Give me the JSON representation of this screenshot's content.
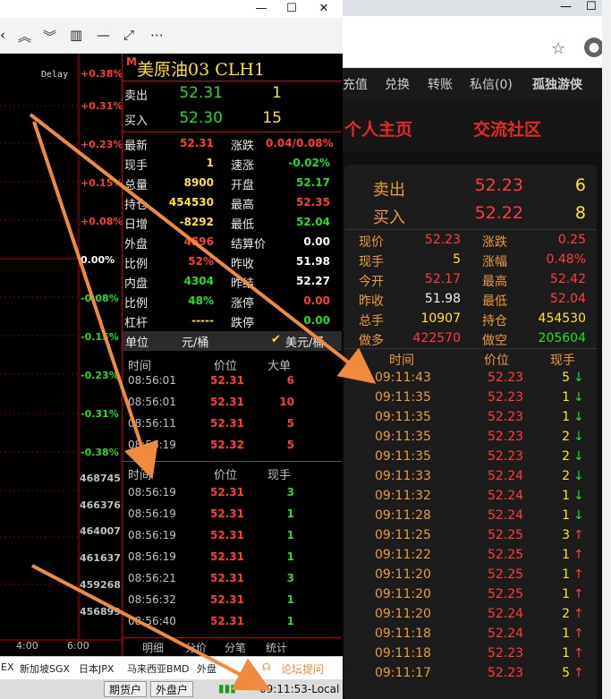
{
  "terminal": {
    "toolbar_icons": [
      "chevrons-up-icon",
      "chevrons-down-icon",
      "layout-icon",
      "minus-icon",
      "draw-line-icon",
      "more-icon"
    ],
    "chart": {
      "delay_label": "Delay",
      "percent_labels": [
        "+0.38%",
        "+0.31%",
        "+0.23%",
        "+0.15%",
        "+0.08%",
        "0.00%",
        "-0.08%",
        "-0.15%",
        "-0.23%",
        "-0.31%",
        "-0.38%"
      ],
      "price_labels": [
        "468745",
        "466376",
        "464007",
        "461637",
        "459268",
        "456899"
      ],
      "time_ticks": [
        "4:00",
        "6:00"
      ]
    },
    "quote": {
      "marker": "M",
      "name": "美原油03  CLH1",
      "sell_label": "卖出",
      "sell_price": "52.31",
      "sell_qty": "1",
      "buy_label": "买入",
      "buy_price": "52.30",
      "buy_qty": "15",
      "stats": [
        {
          "l1": "最新",
          "v1": "52.31",
          "c1": "r",
          "l2": "涨跌",
          "v2": "0.04/0.08%",
          "c2": "r"
        },
        {
          "l1": "现手",
          "v1": "1",
          "c1": "y",
          "l2": "速涨",
          "v2": "-0.02%",
          "c2": "g"
        },
        {
          "l1": "总量",
          "v1": "8900",
          "c1": "y",
          "l2": "开盘",
          "v2": "52.17",
          "c2": "g"
        },
        {
          "l1": "持仓",
          "v1": "454530",
          "c1": "y",
          "l2": "最高",
          "v2": "52.35",
          "c2": "r"
        },
        {
          "l1": "日增",
          "v1": "-8292",
          "c1": "y",
          "l2": "最低",
          "v2": "52.04",
          "c2": "g"
        },
        {
          "l1": "外盘",
          "v1": "4596",
          "c1": "r",
          "l2": "结算价",
          "v2": "0.00",
          "c2": "w"
        },
        {
          "l1": "比例",
          "v1": "52%",
          "c1": "r",
          "l2": "昨收",
          "v2": "51.98",
          "c2": "w"
        },
        {
          "l1": "内盘",
          "v1": "4304",
          "c1": "g",
          "l2": "昨结",
          "v2": "52.27",
          "c2": "w"
        },
        {
          "l1": "比例",
          "v1": "48%",
          "c1": "g",
          "l2": "涨停",
          "v2": "0.00",
          "c2": "r"
        },
        {
          "l1": "杠杆",
          "v1": "-----",
          "c1": "y",
          "l2": "跌停",
          "v2": "0.00",
          "c2": "g"
        }
      ],
      "unit_label": "单位",
      "unit_value": "元/桶",
      "unit_option": "美元/桶",
      "big_orders_headers": [
        "时间",
        "价位",
        "大单"
      ],
      "big_orders": [
        {
          "time": "08:56:01",
          "price": "52.31",
          "qty": "6"
        },
        {
          "time": "08:56:01",
          "price": "52.31",
          "qty": "10"
        },
        {
          "time": "08:56:11",
          "price": "52.31",
          "qty": "5"
        },
        {
          "time": "08:56:19",
          "price": "52.32",
          "qty": "5"
        }
      ],
      "ticks_headers": [
        "时间",
        "价位",
        "现手"
      ],
      "ticks": [
        {
          "time": "08:56:19",
          "price": "52.31",
          "qty": "3"
        },
        {
          "time": "08:56:19",
          "price": "52.31",
          "qty": "1"
        },
        {
          "time": "08:56:19",
          "price": "52.31",
          "qty": "1"
        },
        {
          "time": "08:56:19",
          "price": "52.31",
          "qty": "1"
        },
        {
          "time": "08:56:21",
          "price": "52.31",
          "qty": "3"
        },
        {
          "time": "08:56:32",
          "price": "52.31",
          "qty": "1"
        },
        {
          "time": "08:56:40",
          "price": "52.31",
          "qty": "1"
        }
      ],
      "tabs": [
        "明细",
        "分价",
        "分笔",
        "统计"
      ]
    },
    "market_bar": {
      "items": [
        "EX",
        "新加坡SGX",
        "日本JPX",
        "马来西亚BMD",
        "外盘"
      ],
      "forum_link": "论坛提问"
    },
    "status_bar": {
      "btn1": "期货户",
      "btn2": "外盘户",
      "time": "09:11:53-Local"
    }
  },
  "browser": {
    "nav_items": [
      "充值",
      "兑换",
      "转账",
      "私信(0)",
      "孤独游侠"
    ],
    "headings": [
      "个人主页",
      "交流社区"
    ],
    "sell_label": "卖出",
    "sell_price": "52.23",
    "sell_qty": "6",
    "buy_label": "买入",
    "buy_price": "52.22",
    "buy_qty": "8",
    "stats": [
      {
        "l1": "现价",
        "v1": "52.23",
        "c1": "pr",
        "l2": "涨跌",
        "v2": "0.25",
        "c2": "pr"
      },
      {
        "l1": "现手",
        "v1": "5",
        "c1": "py",
        "l2": "涨幅",
        "v2": "0.48%",
        "c2": "pr"
      },
      {
        "l1": "今开",
        "v1": "52.17",
        "c1": "pr",
        "l2": "最高",
        "v2": "52.42",
        "c2": "pr"
      },
      {
        "l1": "昨收",
        "v1": "51.98",
        "c1": "pw",
        "l2": "最低",
        "v2": "52.04",
        "c2": "pr"
      },
      {
        "l1": "总手",
        "v1": "10907",
        "c1": "py",
        "l2": "持仓",
        "v2": "454530",
        "c2": "py"
      },
      {
        "l1": "做多",
        "v1": "422570",
        "c1": "pr",
        "l2": "做空",
        "v2": "205604",
        "c2": "pg"
      }
    ],
    "ticks_headers": [
      "时间",
      "价位",
      "现手"
    ],
    "ticks": [
      {
        "time": "09:11:43",
        "price": "52.23",
        "qty": "5",
        "dir": "↓"
      },
      {
        "time": "09:11:35",
        "price": "52.23",
        "qty": "1",
        "dir": "↓"
      },
      {
        "time": "09:11:35",
        "price": "52.23",
        "qty": "1",
        "dir": "↓"
      },
      {
        "time": "09:11:35",
        "price": "52.23",
        "qty": "2",
        "dir": "↓"
      },
      {
        "time": "09:11:35",
        "price": "52.23",
        "qty": "2",
        "dir": "↓"
      },
      {
        "time": "09:11:33",
        "price": "52.24",
        "qty": "2",
        "dir": "↓"
      },
      {
        "time": "09:11:32",
        "price": "52.24",
        "qty": "1",
        "dir": "↓"
      },
      {
        "time": "09:11:28",
        "price": "52.24",
        "qty": "1",
        "dir": "↓"
      },
      {
        "time": "09:11:25",
        "price": "52.25",
        "qty": "3",
        "dir": "↑"
      },
      {
        "time": "09:11:22",
        "price": "52.25",
        "qty": "1",
        "dir": "↑"
      },
      {
        "time": "09:11:20",
        "price": "52.25",
        "qty": "1",
        "dir": "↑"
      },
      {
        "time": "09:11:20",
        "price": "52.25",
        "qty": "1",
        "dir": "↑"
      },
      {
        "time": "09:11:20",
        "price": "52.24",
        "qty": "2",
        "dir": "↑"
      },
      {
        "time": "09:11:18",
        "price": "52.24",
        "qty": "1",
        "dir": "↑"
      },
      {
        "time": "09:11:18",
        "price": "52.23",
        "qty": "1",
        "dir": "↑"
      },
      {
        "time": "09:11:17",
        "price": "52.23",
        "qty": "5",
        "dir": "↑"
      }
    ]
  },
  "colors": {
    "up": "#ff3b3b",
    "down": "#22dd22",
    "highlight": "#ffe22b",
    "annotation_arrow": "#f08a3c"
  }
}
